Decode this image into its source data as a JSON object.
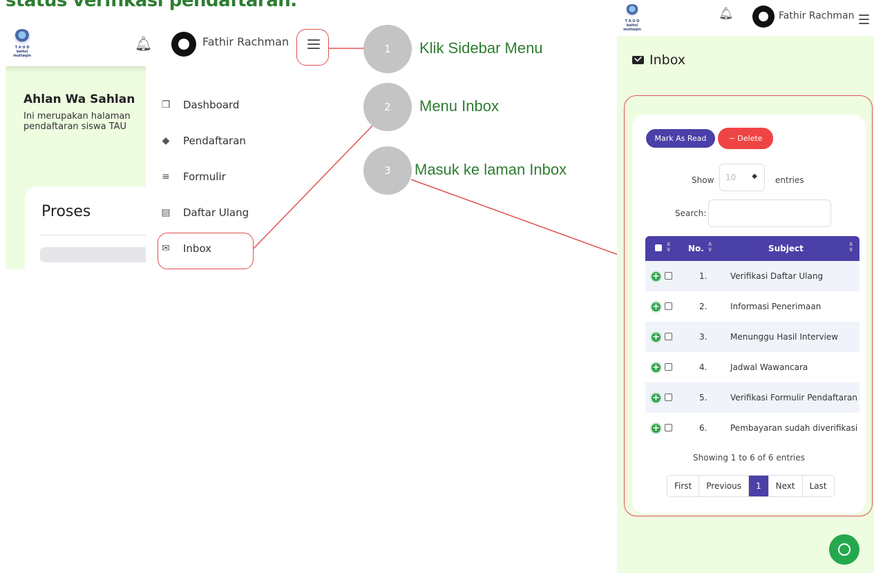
{
  "heading": "status verifikasi pendaftaran.",
  "app": {
    "user_name": "Fathir Rachman",
    "logo_top": "T A U D",
    "logo_bottom": "baitul muttaqin"
  },
  "left_screen": {
    "welcome_title": "Ahlan Wa Sahlan",
    "welcome_text": "Ini merupakan halaman pendaftaran siswa TAU",
    "proses_title": "Proses",
    "sidebar": {
      "items": [
        {
          "label": "Dashboard",
          "icon": "copy-icon"
        },
        {
          "label": "Pendaftaran",
          "icon": "graduation-cap-icon"
        },
        {
          "label": "Formulir",
          "icon": "lines-icon"
        },
        {
          "label": "Daftar Ulang",
          "icon": "list-box-icon"
        },
        {
          "label": "Inbox",
          "icon": "envelope-icon"
        }
      ]
    }
  },
  "callouts": [
    {
      "number": "1",
      "label": "Klik Sidebar Menu"
    },
    {
      "number": "2",
      "label": "Menu Inbox"
    },
    {
      "number": "3",
      "label": "Masuk ke laman Inbox"
    }
  ],
  "right_screen": {
    "page_title": "Inbox",
    "mark_as_read": "Mark As Read",
    "delete": "− Delete",
    "show_label": "Show",
    "show_value": "10",
    "entries_label": "entries",
    "search_label": "Search:",
    "columns": [
      "No.",
      "Subject"
    ],
    "rows": [
      {
        "no": "1.",
        "subject": "Verifikasi Daftar Ulang"
      },
      {
        "no": "2.",
        "subject": "Informasi Penerimaan"
      },
      {
        "no": "3.",
        "subject": "Menunggu Hasil Interview"
      },
      {
        "no": "4.",
        "subject": "Jadwal Wawancara"
      },
      {
        "no": "5.",
        "subject": "Verifikasi Formulir Pendaftaran"
      },
      {
        "no": "6.",
        "subject": "Pembayaran sudah diverifikasi"
      }
    ],
    "showing": "Showing 1 to 6 of 6 entries",
    "pagination": [
      "First",
      "Previous",
      "1",
      "Next",
      "Last"
    ]
  },
  "colors": {
    "accent": "#4b3fa8",
    "callout_green": "#2e7d32",
    "highlight_red": "#e05252",
    "delete_red": "#ef4444",
    "page_bg": "#eefce0"
  }
}
